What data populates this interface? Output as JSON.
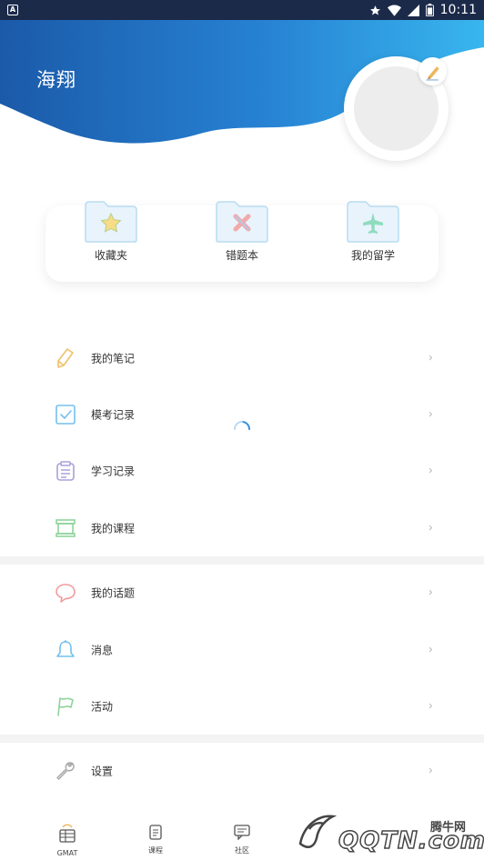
{
  "status_bar": {
    "time": "10:11"
  },
  "profile": {
    "name": "海翔"
  },
  "quick_links": [
    {
      "label": "收藏夹",
      "icon": "star-folder-icon"
    },
    {
      "label": "错题本",
      "icon": "x-folder-icon"
    },
    {
      "label": "我的留学",
      "icon": "plane-folder-icon"
    }
  ],
  "menu_group_1": [
    {
      "label": "我的笔记",
      "icon": "pencil-icon"
    },
    {
      "label": "模考记录",
      "icon": "checkbox-icon"
    },
    {
      "label": "学习记录",
      "icon": "clipboard-icon"
    },
    {
      "label": "我的课程",
      "icon": "course-icon"
    }
  ],
  "menu_group_2": [
    {
      "label": "我的话题",
      "icon": "speech-bubble-icon"
    },
    {
      "label": "消息",
      "icon": "bell-icon"
    },
    {
      "label": "活动",
      "icon": "flag-icon"
    }
  ],
  "menu_group_3": [
    {
      "label": "设置",
      "icon": "wrench-icon"
    }
  ],
  "bottom_nav": [
    {
      "label": "GMAT"
    },
    {
      "label": "课程"
    },
    {
      "label": "社区"
    }
  ],
  "watermark": {
    "brand": "腾牛网",
    "domain": "QQTN.com"
  },
  "colors": {
    "header_dark": "#1e5aa8",
    "header_light": "#36b0ea",
    "accent_blue": "#2f8fe0"
  }
}
